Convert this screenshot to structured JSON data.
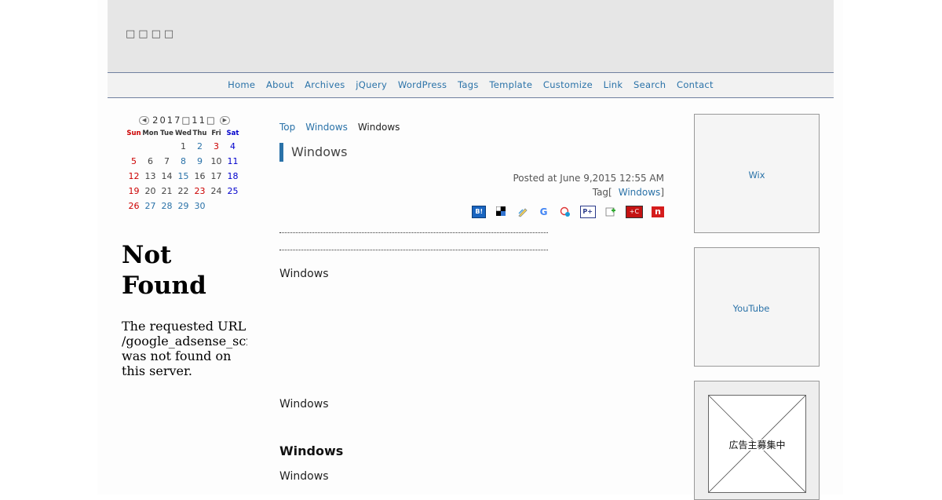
{
  "header": {
    "site_title": "□□□□"
  },
  "nav": {
    "items": [
      "Home",
      "About",
      "Archives",
      "jQuery",
      "WordPress",
      "Tags",
      "Template",
      "Customize",
      "Link",
      "Search",
      "Contact"
    ]
  },
  "calendar": {
    "title": "2017□11□",
    "prev_icon": "prev-arrow-icon",
    "next_icon": "next-arrow-icon",
    "weekdays": [
      "Sun",
      "Mon",
      "Tue",
      "Wed",
      "Thu",
      "Fri",
      "Sat"
    ],
    "weeks": [
      [
        "",
        "",
        "",
        "1",
        "2",
        "3",
        "4"
      ],
      [
        "5",
        "6",
        "7",
        "8",
        "9",
        "10",
        "11"
      ],
      [
        "12",
        "13",
        "14",
        "15",
        "16",
        "17",
        "18"
      ],
      [
        "19",
        "20",
        "21",
        "22",
        "23",
        "24",
        "25"
      ],
      [
        "26",
        "27",
        "28",
        "29",
        "30",
        "",
        ""
      ]
    ]
  },
  "error": {
    "heading": "Not Found",
    "message": "The requested URL\n/google_adsense_scr\nwas not found on\nthis server."
  },
  "breadcrumb": {
    "top": "Top",
    "category": "Windows",
    "current": "Windows"
  },
  "post": {
    "title": "Windows",
    "posted": "Posted at June 9,2015 12:55 AM",
    "tag_label": "Tag[",
    "tag": "Windows",
    "tag_close": "]",
    "para1": "Windows",
    "para2": "Windows",
    "heading": "Windows",
    "para3": "Windows"
  },
  "share_icons": [
    "hatena-bookmark-icon",
    "delicious-icon",
    "livedoor-clip-icon",
    "google-bookmark-icon",
    "buzzurl-icon",
    "pookmark-icon",
    "yahoo-bookmark-icon",
    "choix-icon",
    "newsing-icon"
  ],
  "sidebar": {
    "box1": "Wix",
    "box2": "YouTube",
    "ad": "広告主募集中"
  },
  "colors": {
    "link": "#2a72a8",
    "header_bg": "#e6e6e6",
    "accent": "#2a72a8"
  }
}
